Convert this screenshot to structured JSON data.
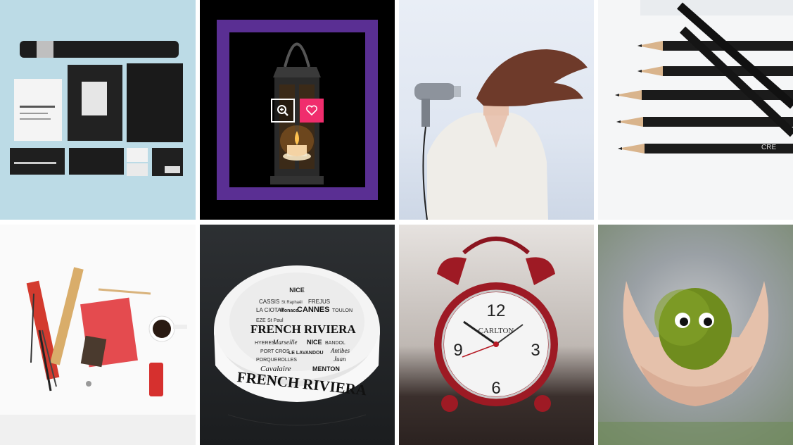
{
  "gallery": {
    "tiles": [
      {
        "subject": "stationery mockup"
      },
      {
        "subject": "lantern"
      },
      {
        "subject": "hair dryer"
      },
      {
        "subject": "pencils"
      },
      {
        "subject": "desk supplies"
      },
      {
        "subject": "ashtray"
      },
      {
        "subject": "alarm clock"
      },
      {
        "subject": "moss creature"
      }
    ],
    "overlay": {
      "zoom_icon": "zoom-in-icon",
      "like_icon": "heart-icon",
      "accent_color": "#5a2f93",
      "like_color": "#f02d6d"
    }
  },
  "texts": {
    "ashtray_rim": "FRENCH RIVIERA",
    "ashtray_big": "FRENCH RIVIERA",
    "ashtray_towns": [
      "NICE",
      "CASSIS",
      "St Raphaël",
      "FREJUS",
      "LA CIOTAT",
      "Monaco",
      "CANNES",
      "TOULON",
      "EZE",
      "St Paul",
      "HYERES",
      "Marseille",
      "NICE",
      "BANDOL",
      "PORT CROS",
      "LE LAVANDOU",
      "Antibes",
      "PORQUEROLLES",
      "Juan",
      "Cavalaire",
      "MENTON"
    ],
    "clock_brand": "CARLTON",
    "clock_numbers": [
      "12",
      "3",
      "6",
      "9"
    ],
    "pencil_brand": "CRE"
  }
}
